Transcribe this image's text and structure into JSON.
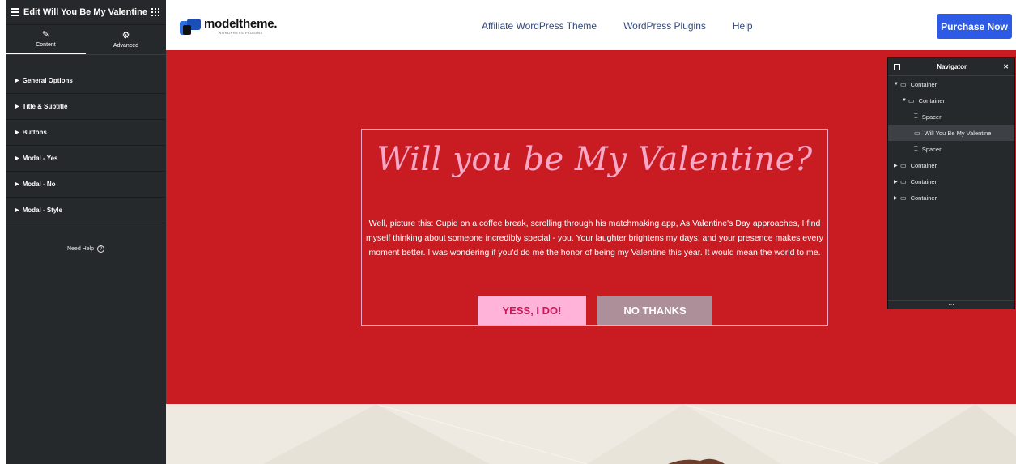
{
  "panel": {
    "title": "Edit Will You Be My Valentine",
    "tabs": [
      {
        "label": "Content",
        "icon": "pencil-icon"
      },
      {
        "label": "Advanced",
        "icon": "gear-icon"
      }
    ],
    "sections": [
      {
        "label": "General Options"
      },
      {
        "label": "Title & Subtitle"
      },
      {
        "label": "Buttons"
      },
      {
        "label": "Modal - Yes"
      },
      {
        "label": "Modal - No"
      },
      {
        "label": "Modal - Style"
      }
    ],
    "need_help": "Need Help"
  },
  "header": {
    "brand": "modeltheme.",
    "tagline": "WORDPRESS PLUGINS",
    "nav": [
      "Affiliate WordPress Theme",
      "WordPress Plugins",
      "Help"
    ],
    "cta": "Purchase Now"
  },
  "hero": {
    "title": "Will you be My Valentine?",
    "text": "Well, picture this: Cupid on a coffee break, scrolling through his matchmaking app, As Valentine's Day approaches, I find myself thinking about someone incredibly special - you. Your laughter brightens my days, and your presence makes every moment better. I was wondering if you'd do me the honor of being my Valentine this year. It would mean the world to me.",
    "yes_label": "YESS, I DO!",
    "no_label": "NO THANKS"
  },
  "navigator": {
    "title": "Navigator",
    "items": [
      {
        "label": "Container",
        "icon": "container-icon",
        "expanded": true
      },
      {
        "label": "Container",
        "icon": "container-icon",
        "expanded": true
      },
      {
        "label": "Spacer",
        "icon": "spacer-icon"
      },
      {
        "label": "Will You Be My Valentine",
        "icon": "widget-icon",
        "selected": true
      },
      {
        "label": "Spacer",
        "icon": "spacer-icon"
      },
      {
        "label": "Container",
        "icon": "container-icon",
        "expanded": false
      },
      {
        "label": "Container",
        "icon": "container-icon",
        "expanded": false
      },
      {
        "label": "Container",
        "icon": "container-icon",
        "expanded": false
      }
    ]
  },
  "colors": {
    "hero_bg": "#c91c22",
    "accent_pink": "#f7a8c6",
    "yes_bg": "#ffb3d9",
    "no_bg": "#ad8f99",
    "cta_bg": "#2e5be5",
    "panel_bg": "#26292c"
  }
}
